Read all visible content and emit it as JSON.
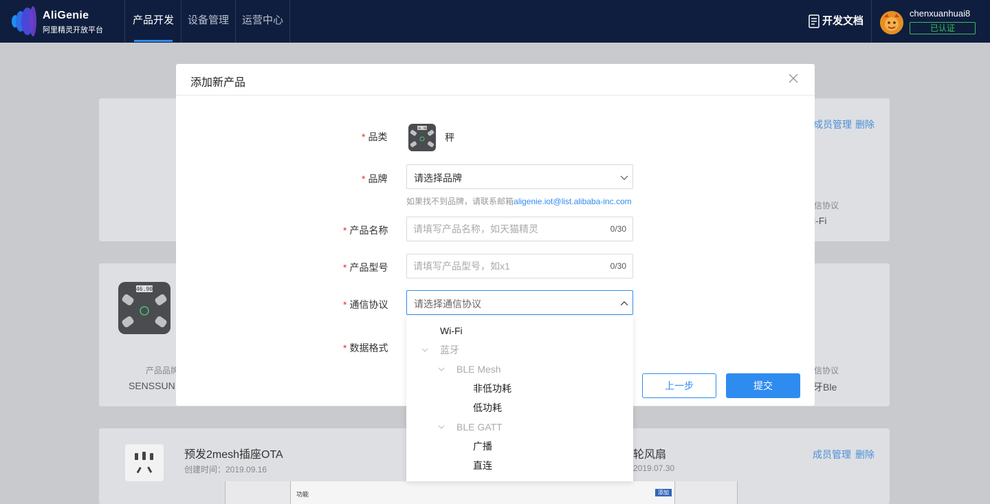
{
  "navbar": {
    "brand_name": "AliGenie",
    "brand_sub": "阿里精灵开放平台",
    "tabs": [
      {
        "label": "产品开发",
        "active": true
      },
      {
        "label": "设备管理",
        "active": false
      },
      {
        "label": "运营中心",
        "active": false
      }
    ],
    "docs_label": "开发文档",
    "username": "chenxuanhuai8",
    "verified_badge": "已认证"
  },
  "background": {
    "card1": {
      "links": [
        "成员管理",
        "删除"
      ],
      "protocol_label": "信协议",
      "protocol_value": "i-Fi"
    },
    "card2": {
      "brand_label": "产品品牌",
      "brand_value": "SENSSUN",
      "protocol_label": "信协议",
      "protocol_value": "牙Ble"
    },
    "card3": {
      "title": "预发2mesh插座OTA",
      "created": "创建时间：2019.09.16",
      "right_title": "轮风扇",
      "right_created": "2019.07.30",
      "links": [
        "成员管理",
        "删除"
      ]
    },
    "bottom_strip": {
      "label": "功能",
      "tag": "添加"
    }
  },
  "modal": {
    "title": "添加新产品",
    "labels": {
      "category": "品类",
      "brand": "品牌",
      "product_name": "产品名称",
      "product_model": "产品型号",
      "protocol": "通信协议",
      "data_format": "数据格式"
    },
    "category_value": "秤",
    "category_display": "46.90",
    "brand_placeholder": "请选择品牌",
    "brand_hint_prefix": "如果找不到品牌，请联系邮箱",
    "brand_hint_email": "aligenie.iot@list.alibaba-inc.com",
    "product_name_placeholder": "请填写产品名称，如天猫精灵",
    "product_name_count": "0/30",
    "product_model_placeholder": "请填写产品型号，如x1",
    "product_model_count": "0/30",
    "protocol_placeholder": "请选择通信协议",
    "buttons": {
      "prev": "上一步",
      "submit": "提交"
    }
  },
  "protocol_dropdown": {
    "items": [
      {
        "label": "Wi-Fi",
        "type": "leaf",
        "level": 0
      },
      {
        "label": "蓝牙",
        "type": "group",
        "level": 0
      },
      {
        "label": "BLE Mesh",
        "type": "group",
        "level": 1
      },
      {
        "label": "非低功耗",
        "type": "leaf",
        "level": 2
      },
      {
        "label": "低功耗",
        "type": "leaf",
        "level": 2
      },
      {
        "label": "BLE GATT",
        "type": "group",
        "level": 1
      },
      {
        "label": "广播",
        "type": "leaf",
        "level": 2
      },
      {
        "label": "直连",
        "type": "leaf",
        "level": 2
      }
    ]
  },
  "colors": {
    "navbar_bg": "#0f1e3e",
    "accent": "#2e8bf0",
    "required": "#e62e2e",
    "verified": "#3dbb5a"
  }
}
